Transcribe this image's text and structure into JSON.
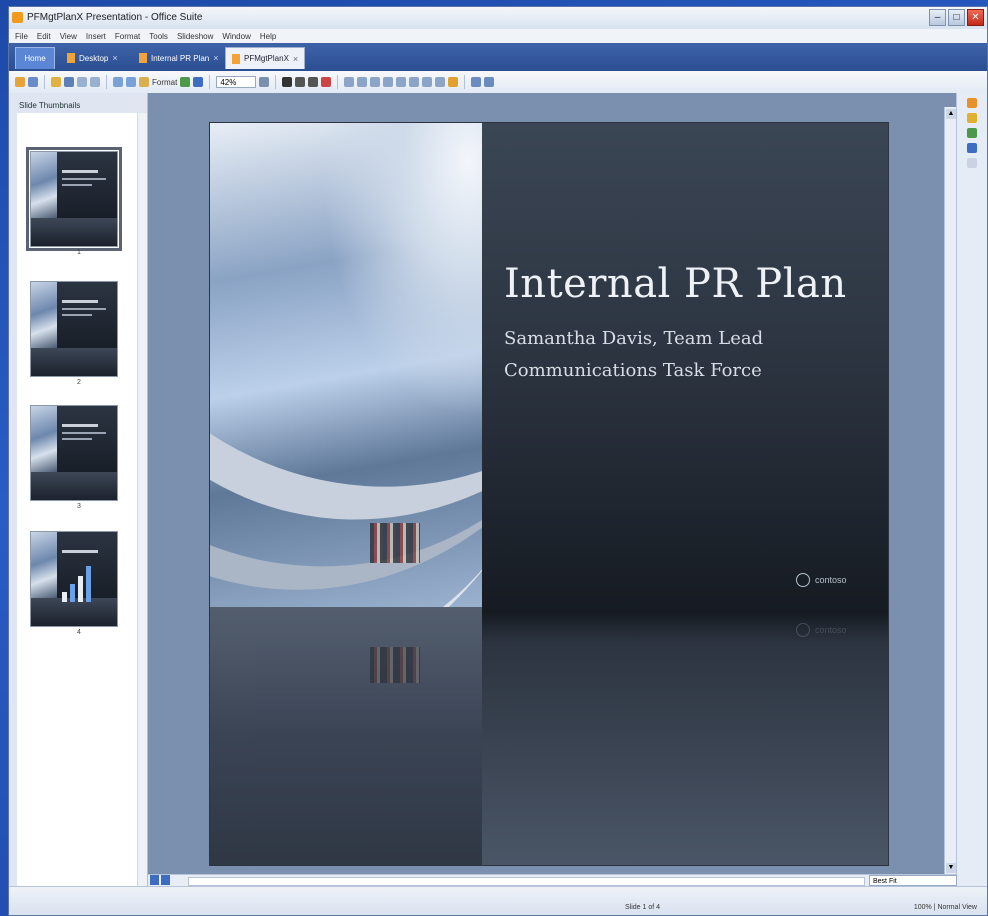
{
  "window": {
    "title": "PFMgtPlanX Presentation - Office Suite"
  },
  "menu": [
    "File",
    "Edit",
    "View",
    "Insert",
    "Format",
    "Tools",
    "Slideshow",
    "Window",
    "Help"
  ],
  "tabs": [
    {
      "label": "Home",
      "kind": "home"
    },
    {
      "label": "Desktop"
    },
    {
      "label": "Internal PR Plan"
    },
    {
      "label": "PFMgtPlanX"
    }
  ],
  "toolbar": {
    "zoom_value": "42%",
    "format_label": "Format"
  },
  "left_panel": {
    "header": "Slide Thumbnails",
    "thumbnails": [
      "1",
      "2",
      "3",
      "4"
    ]
  },
  "slide": {
    "title": "Internal PR Plan",
    "subtitle_line1": "Samantha Davis, Team Lead",
    "subtitle_line2": "Communications Task Force",
    "logo_text": "contoso"
  },
  "view": {
    "fit_option": "Best Fit"
  },
  "status": {
    "left": "Slide 1 of 4",
    "right": "100% | Normal View"
  },
  "colors": {
    "desktop": "#1d4aa8",
    "tabbar": "#2b4e93",
    "canvas": "#7b8fae",
    "slide_dark": "#161b22"
  }
}
